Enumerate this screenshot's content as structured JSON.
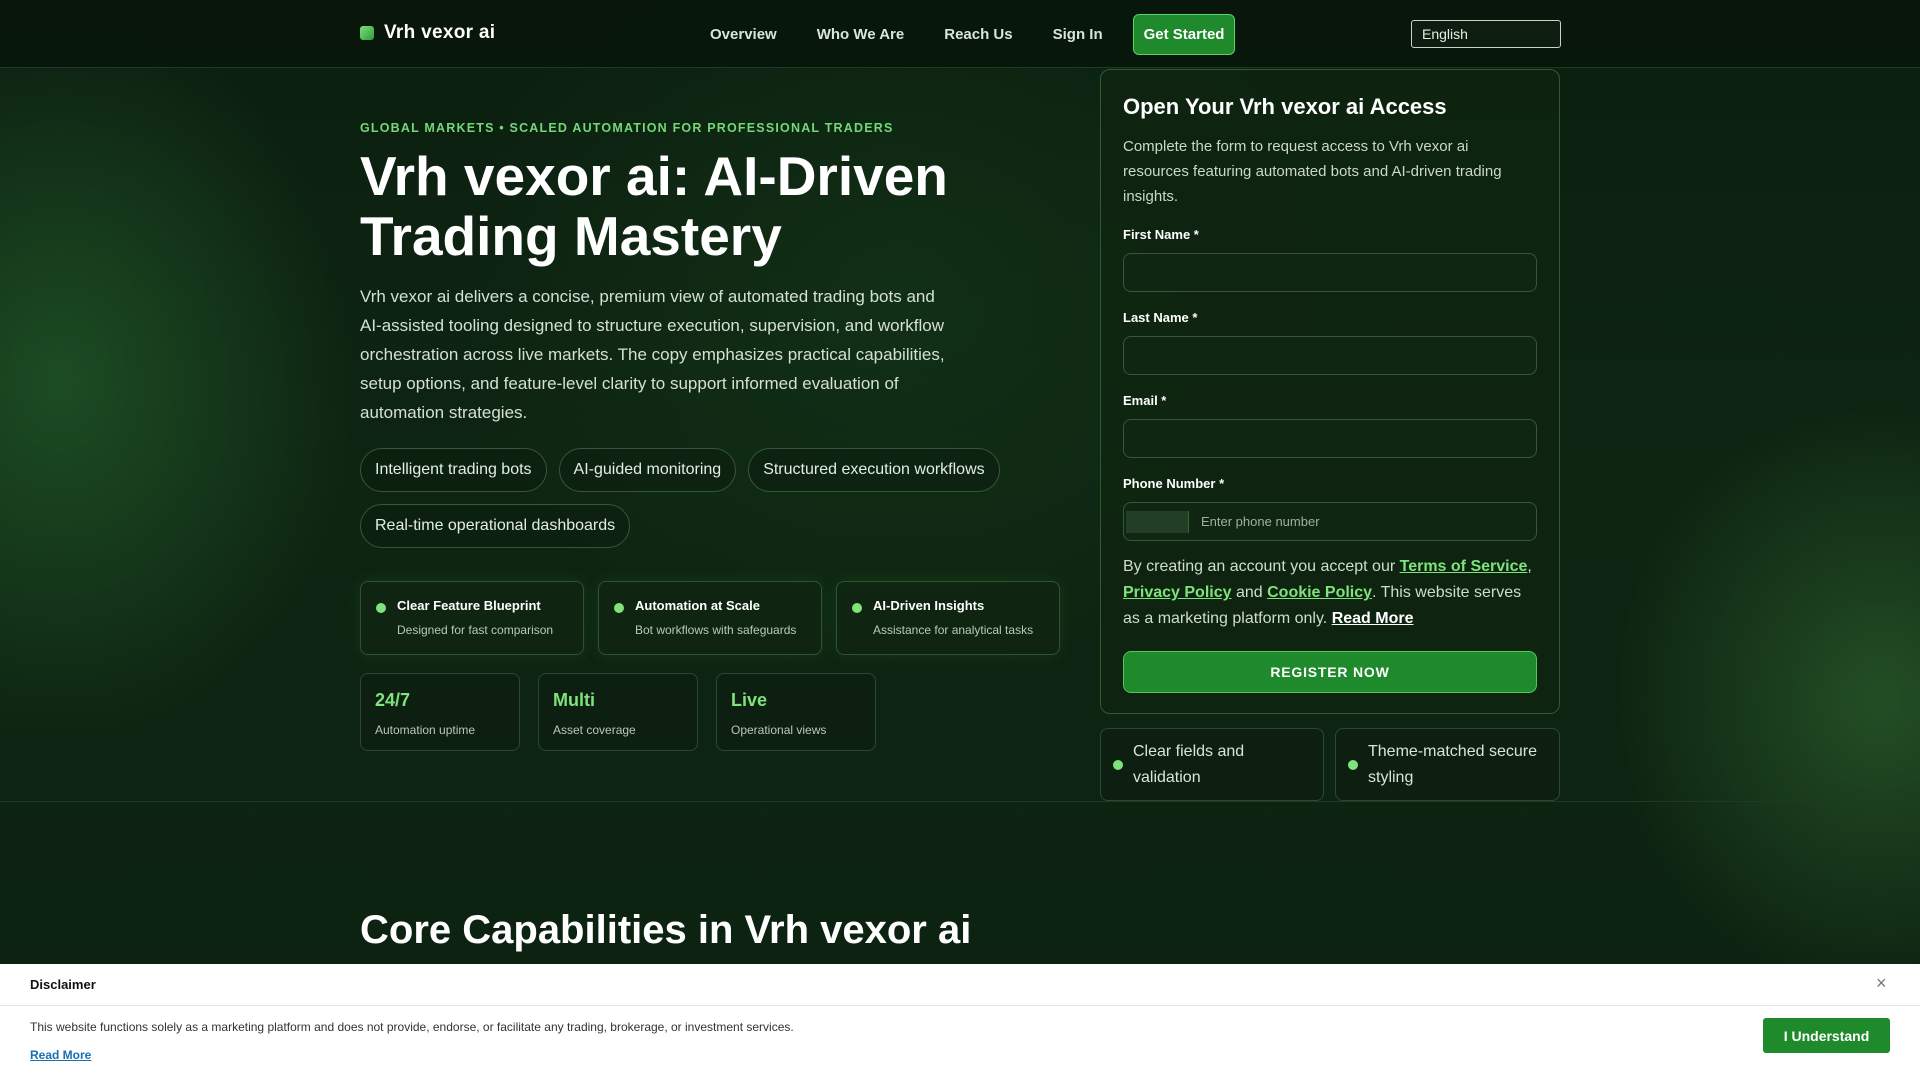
{
  "header": {
    "brand": "Vrh vexor ai",
    "nav": [
      "Overview",
      "Who We Are",
      "Reach Us",
      "Sign In"
    ],
    "cta": "Get Started",
    "language": "English"
  },
  "hero": {
    "eyebrow": "GLOBAL MARKETS • SCALED AUTOMATION FOR PROFESSIONAL TRADERS",
    "title": "Vrh vexor ai: AI-Driven Trading Mastery",
    "description": "Vrh vexor ai delivers a concise, premium view of automated trading bots and AI-assisted tooling designed to structure execution, supervision, and workflow orchestration across live markets. The copy emphasizes practical capabilities, setup options, and feature-level clarity to support informed evaluation of automation strategies.",
    "pills": [
      "Intelligent trading bots",
      "AI-guided monitoring",
      "Structured execution workflows",
      "Real-time operational dashboards"
    ],
    "features": [
      {
        "title": "Clear Feature Blueprint",
        "subtitle": "Designed for fast comparison"
      },
      {
        "title": "Automation at Scale",
        "subtitle": "Bot workflows with safeguards"
      },
      {
        "title": "AI-Driven Insights",
        "subtitle": "Assistance for analytical tasks"
      }
    ],
    "stats": [
      {
        "value": "24/7",
        "label": "Automation uptime"
      },
      {
        "value": "Multi",
        "label": "Asset coverage"
      },
      {
        "value": "Live",
        "label": "Operational views"
      }
    ]
  },
  "form": {
    "title": "Open Your Vrh vexor ai Access",
    "intro": "Complete the form to request access to Vrh vexor ai resources featuring automated bots and AI-driven trading insights.",
    "first_name_label": "First Name *",
    "last_name_label": "Last Name *",
    "email_label": "Email *",
    "phone_label": "Phone Number *",
    "phone_placeholder": "Enter phone number",
    "terms_prefix": "By creating an account you accept our ",
    "terms_link": "Terms of Service",
    "comma": ",",
    "privacy_link": "Privacy Policy",
    "and": " and ",
    "cookie_link": "Cookie Policy",
    "terms_suffix": ". This website serves as a marketing platform only. ",
    "read_more": "Read More",
    "submit": "REGISTER NOW",
    "notes": [
      "Clear fields and validation",
      "Theme-matched secure styling"
    ]
  },
  "section": {
    "title": "Core Capabilities in Vrh vexor ai"
  },
  "disclaimer": {
    "title": "Disclaimer",
    "close": "×",
    "text": "This website functions solely as a marketing platform and does not provide, endorse, or facilitate any trading, brokerage, or investment services.",
    "read_more": "Read More",
    "button": "I Understand"
  },
  "colors": {
    "accent": "#7ee37b",
    "button": "#1e8a2b",
    "background": "#0b1a0e"
  }
}
